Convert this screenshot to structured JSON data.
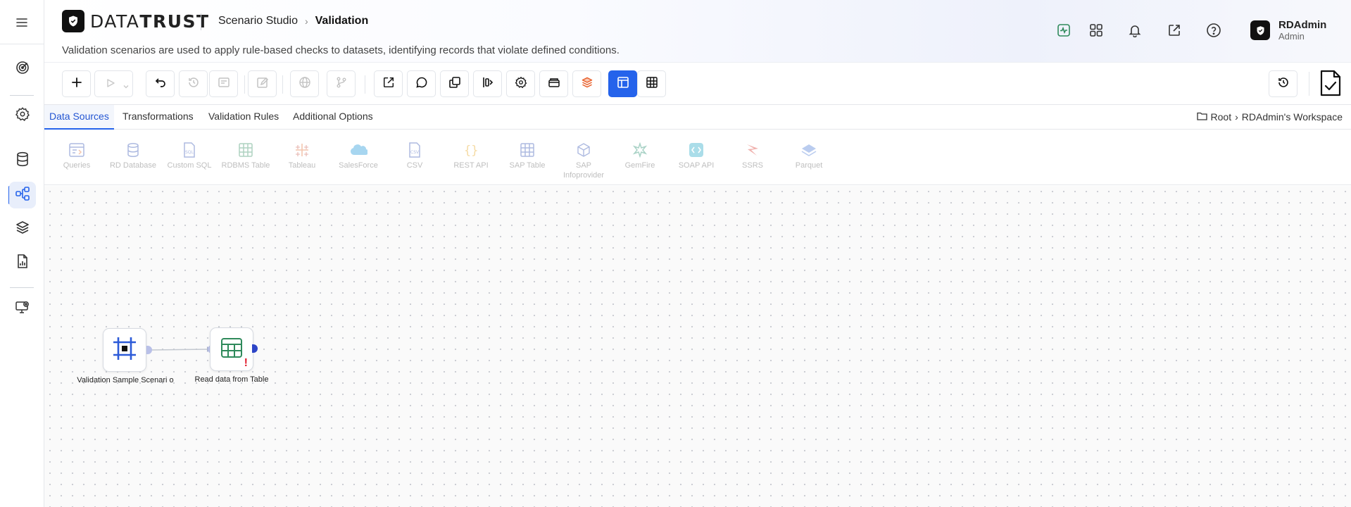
{
  "app": {
    "brand_light": "DATA",
    "brand_bold": "TRUST",
    "breadcrumb": [
      "Scenario Studio",
      "Validation"
    ],
    "subtitle": "Validation scenarios are used to apply rule-based checks to datasets, identifying records that violate defined conditions."
  },
  "header_icons": [
    "activity-icon",
    "apps-grid-icon",
    "bell-icon",
    "external-link-icon",
    "help-icon"
  ],
  "user": {
    "name": "RDAdmin",
    "role": "Admin"
  },
  "sidebar": {
    "items": [
      {
        "icon": "target-icon"
      },
      {
        "icon": "gear-icon"
      },
      {
        "icon": "database-icon"
      },
      {
        "icon": "flow-icon",
        "active": true
      },
      {
        "icon": "layers-icon"
      },
      {
        "icon": "report-icon"
      },
      {
        "icon": "monitor-settings-icon"
      }
    ]
  },
  "tabs": [
    "Data Sources",
    "Transformations",
    "Validation Rules",
    "Additional Options"
  ],
  "workspace_path": {
    "root": "Root",
    "workspace": "RDAdmin's Workspace"
  },
  "data_sources": [
    "Queries",
    "RD Database",
    "Custom SQL",
    "RDBMS Table",
    "Tableau",
    "SalesForce",
    "CSV",
    "REST API",
    "SAP Table",
    "SAP Infoprovider",
    "GemFire",
    "SOAP API",
    "SSRS",
    "Parquet"
  ],
  "nodes": [
    {
      "label": "Validation Sample Scenari o"
    },
    {
      "label": "Read data from Table",
      "warning": "!"
    }
  ],
  "colors": {
    "accent": "#2563eb",
    "warning": "#e11d2e",
    "table_green": "#2f8a5b"
  }
}
